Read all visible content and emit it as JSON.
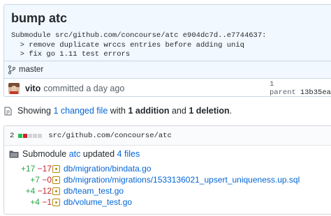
{
  "commit": {
    "title": "bump atc",
    "description": "Submodule src/github.com/concourse/atc e904dc7d..e7744637:\n  > remove duplicate wrccs entries before adding uniq\n  > fix go 1.11 test errors",
    "branch": "master",
    "author": "vito",
    "committed_text": "committed a day ago",
    "parent_label": "1 parent",
    "parent_sha": "13b35ea"
  },
  "summary": {
    "prefix": "Showing ",
    "changed_files_link": "1 changed file",
    "with": " with ",
    "additions": "1 addition",
    "and": " and ",
    "deletions": "1 deletion",
    "suffix": "."
  },
  "file": {
    "changes_count": "2",
    "path": "src/github.com/concourse/atc",
    "diffstat_blocks": [
      "add",
      "del",
      "neu",
      "neu",
      "neu"
    ],
    "submodule_prefix": "Submodule ",
    "submodule_name": "atc",
    "submodule_updated": " updated ",
    "files_link": "4 files"
  },
  "changes": [
    {
      "plus": "+17",
      "minus": "−17",
      "path": "db/migration/bindata.go"
    },
    {
      "plus": "+7",
      "minus": "−0",
      "path": "db/migration/migrations/1533136021_upsert_uniqueness.up.sql"
    },
    {
      "plus": "+4",
      "minus": "−12",
      "path": "db/team_test.go"
    },
    {
      "plus": "+4",
      "minus": "−1",
      "path": "db/volume_test.go"
    }
  ],
  "colors": {
    "header_bg": "#f1f8ff",
    "link": "#0366d6",
    "addition": "#28a745",
    "deletion": "#cb2431"
  },
  "icons": {
    "branch": "git-branch-icon",
    "summary": "file-diff-icon",
    "folder": "folder-icon",
    "modified": "file-modified-icon"
  }
}
